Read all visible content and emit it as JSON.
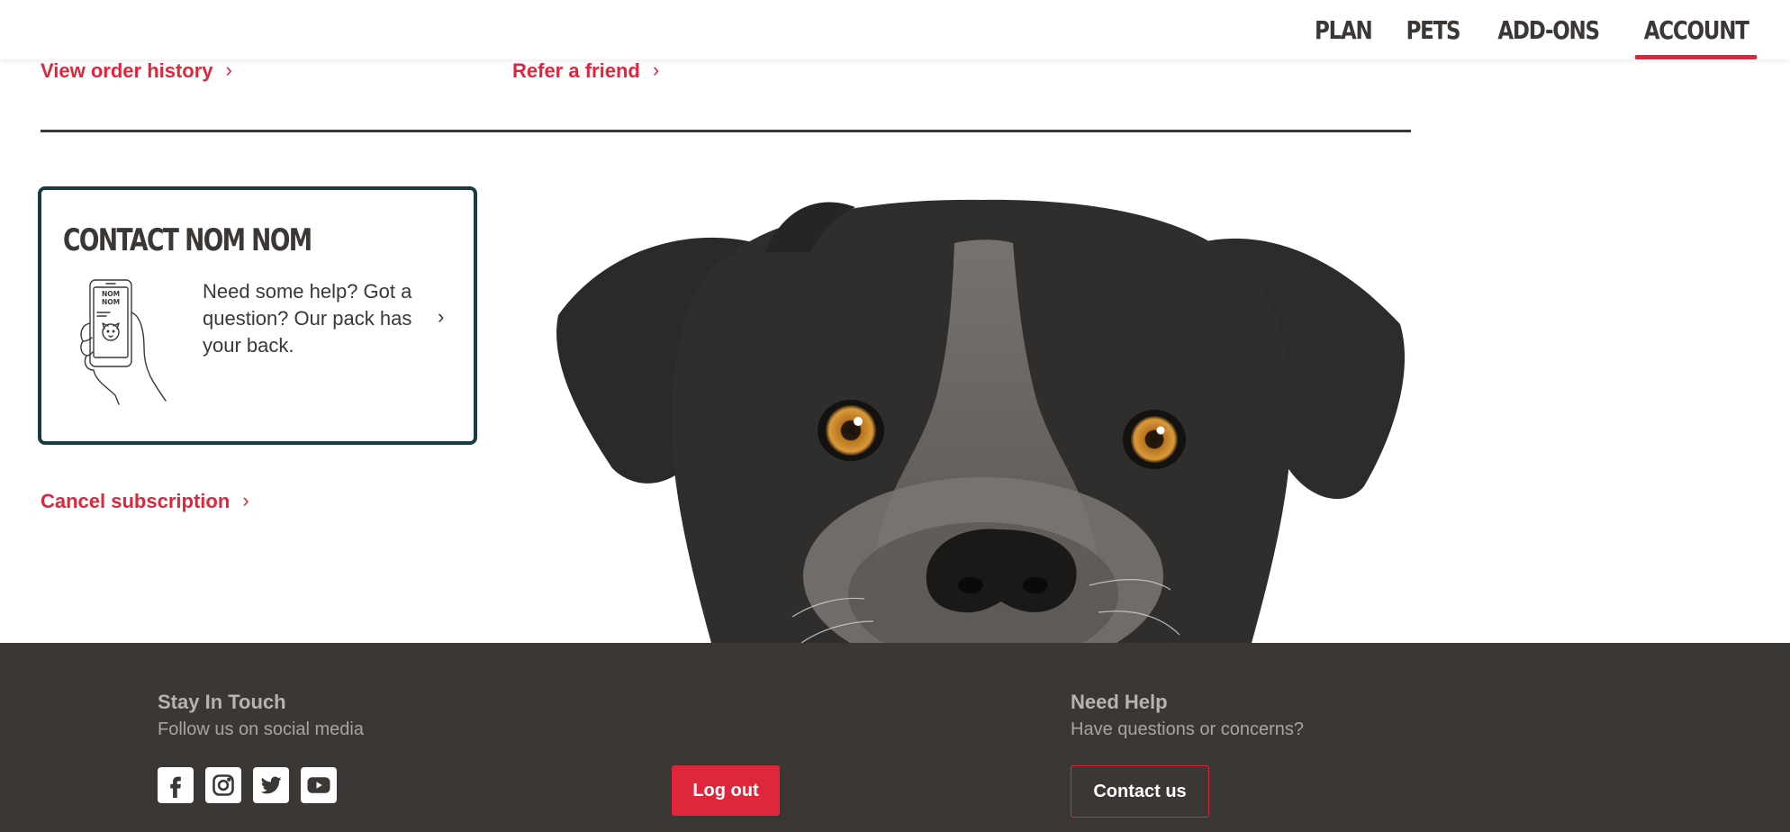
{
  "nav": {
    "items": [
      {
        "label": "PLAN"
      },
      {
        "label": "PETS"
      },
      {
        "label": "ADD-ONS"
      },
      {
        "label": "ACCOUNT",
        "active": true
      }
    ]
  },
  "links": {
    "order_history": "View order history",
    "refer_friend": "Refer a friend",
    "cancel_subscription": "Cancel subscription",
    "chevron": "›"
  },
  "contact_card": {
    "title": "CONTACT NOM NOM",
    "text": "Need some help? Got a question? Our pack has your back.",
    "phone_logo": "NOM NOM",
    "icon": "phone-in-hand-icon"
  },
  "footer": {
    "stay_in_touch": {
      "heading": "Stay In Touch",
      "subheading": "Follow us on social media",
      "socials": [
        "facebook-icon",
        "instagram-icon",
        "twitter-icon",
        "youtube-icon"
      ]
    },
    "logout_label": "Log out",
    "need_help": {
      "heading": "Need Help",
      "subheading": "Have questions or concerns?",
      "button_label": "Contact us"
    }
  },
  "colors": {
    "accent": "#e0263b",
    "dark": "#3b3734",
    "card_border": "#183a44"
  }
}
